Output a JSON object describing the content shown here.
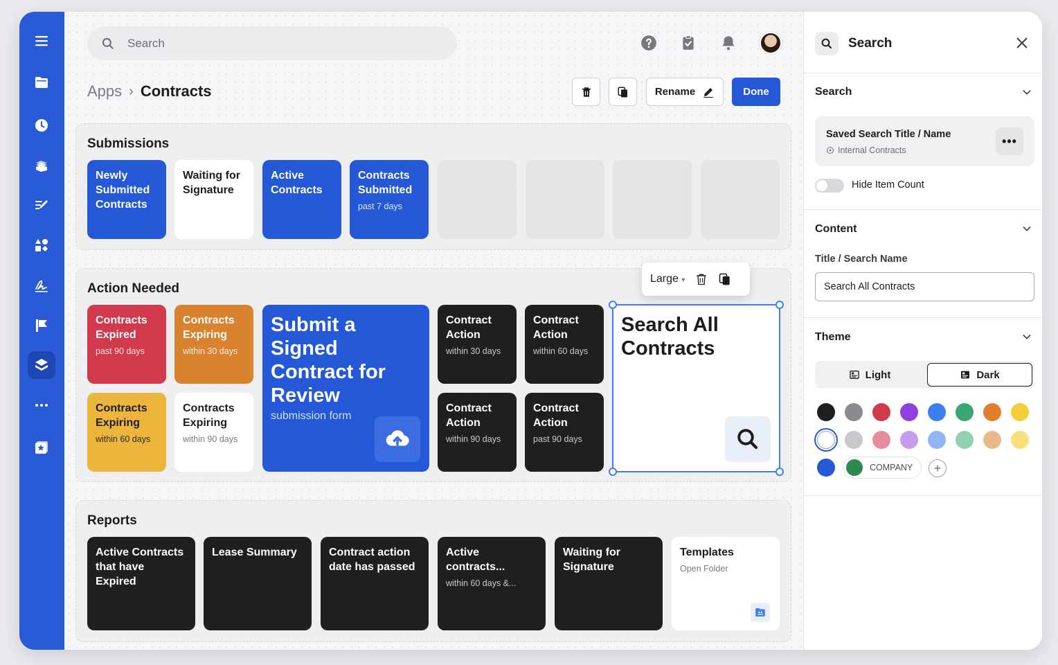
{
  "search": {
    "placeholder": "Search"
  },
  "breadcrumb": {
    "parent": "Apps",
    "current": "Contracts"
  },
  "toolbar": {
    "rename_label": "Rename",
    "done_label": "Done"
  },
  "sections": {
    "submissions": {
      "title": "Submissions",
      "tiles": [
        {
          "title": "Newly Submitted Contracts",
          "sub": ""
        },
        {
          "title": "Waiting for Signature",
          "sub": ""
        },
        {
          "title": "Active Contracts",
          "sub": ""
        },
        {
          "title": "Contracts Submitted",
          "sub": "past 7 days"
        }
      ]
    },
    "action": {
      "title": "Action Needed",
      "tiles": [
        {
          "title": "Contracts Expired",
          "sub": "past 90 days"
        },
        {
          "title": "Contracts Expiring",
          "sub": "within 30 days"
        },
        {
          "title": "Contracts Expiring",
          "sub": "within 60 days"
        },
        {
          "title": "Contracts Expiring",
          "sub": "within 90 days"
        },
        {
          "title": "Contract Action",
          "sub": "within 30 days"
        },
        {
          "title": "Contract Action",
          "sub": "within 60 days"
        },
        {
          "title": "Contract Action",
          "sub": "within 90 days"
        },
        {
          "title": "Contract Action",
          "sub": "past 90 days"
        }
      ],
      "submit_tile": {
        "title": "Submit a Signed Contract for Review",
        "sub": "submission form"
      },
      "search_tile": {
        "title": "Search All Contracts"
      },
      "popover": {
        "size_label": "Large"
      }
    },
    "reports": {
      "title": "Reports",
      "tiles": [
        {
          "title": "Active Contracts that have Expired",
          "sub": ""
        },
        {
          "title": "Lease Summary",
          "sub": ""
        },
        {
          "title": "Contract action date has passed",
          "sub": ""
        },
        {
          "title": "Active contracts...",
          "sub": "within 60 days &..."
        },
        {
          "title": "Waiting for Signature",
          "sub": ""
        },
        {
          "title": "Templates",
          "sub": "Open Folder"
        }
      ]
    }
  },
  "panel": {
    "title": "Search",
    "search_section": {
      "title": "Search",
      "saved_title": "Saved Search Title / Name",
      "saved_sub": "Internal Contracts",
      "hide_count_label": "Hide Item Count"
    },
    "content_section": {
      "title": "Content",
      "field_label": "Title / Search Name",
      "field_value": "Search All Contracts"
    },
    "theme_section": {
      "title": "Theme",
      "light_label": "Light",
      "dark_label": "Dark",
      "company_label": "COMPANY",
      "swatches_row1": [
        "#1f1f21",
        "#8a8b90",
        "#d1394d",
        "#8e3fe0",
        "#3b7ff2",
        "#3aa672",
        "#e07f2e",
        "#f2cf3a"
      ],
      "swatches_row2": [
        "#ffffff",
        "#c8c9cd",
        "#e78c9b",
        "#c89bee",
        "#8fb5f5",
        "#8fd1b0",
        "#eab98b",
        "#f8e07c"
      ],
      "swatches_row3": [
        "#2458d6"
      ]
    }
  },
  "colors": {
    "brand_blue": "#2458d6",
    "sidebar": "#2a5bd7"
  }
}
